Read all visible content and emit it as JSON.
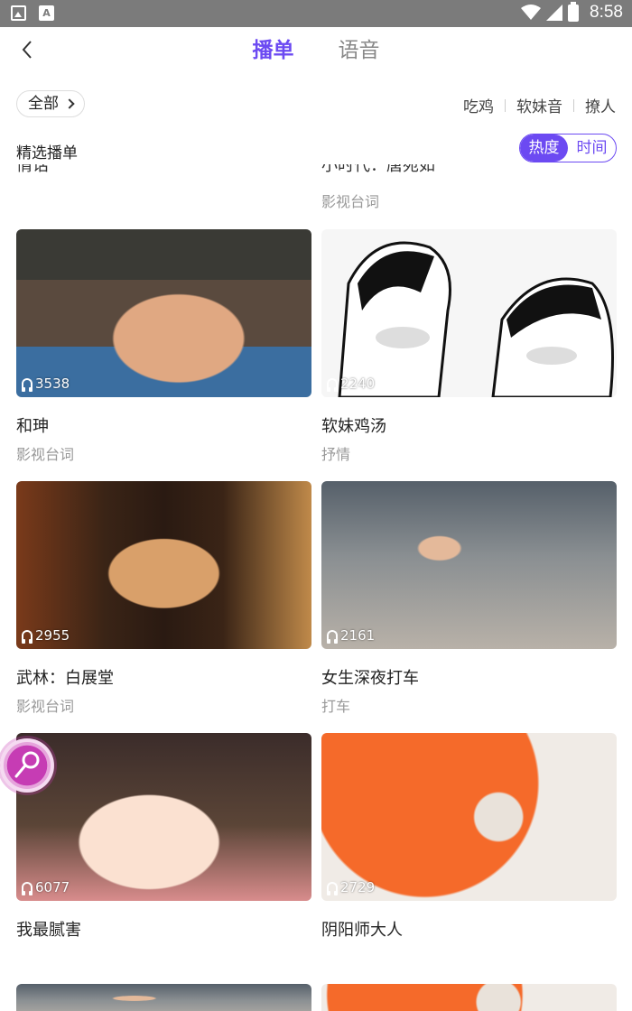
{
  "status_bar": {
    "time": "8:58"
  },
  "header": {
    "back_icon": "chevron-left-icon",
    "tabs": [
      {
        "label": "播单",
        "active": true
      },
      {
        "label": "语音",
        "active": false
      }
    ]
  },
  "filters": {
    "all_label": "全部",
    "quick_tags": [
      "吃鸡",
      "软妹音",
      "撩人"
    ]
  },
  "section": {
    "title": "精选播单",
    "sort_options": [
      {
        "label": "热度",
        "active": true
      },
      {
        "label": "时间",
        "active": false
      }
    ]
  },
  "partial_row": {
    "left_title": "情话",
    "right_title": "小时代：唐宛如",
    "right_sub": "影视台词"
  },
  "cards": [
    {
      "plays": "3538",
      "title": "和珅",
      "sub": "影视台词"
    },
    {
      "plays": "2240",
      "title": "软妹鸡汤",
      "sub": "抒情"
    },
    {
      "plays": "2955",
      "title": "武林：白展堂",
      "sub": "影视台词"
    },
    {
      "plays": "2161",
      "title": "女生深夜打车",
      "sub": "打车"
    },
    {
      "plays": "6077",
      "title": "我最腻害",
      "sub": ""
    },
    {
      "plays": "2729",
      "title": "阴阳师大人",
      "sub": ""
    }
  ],
  "colors": {
    "accent": "#6c4af2",
    "status_bar": "#7b7b7b"
  },
  "fab_icon": "microphone-icon"
}
